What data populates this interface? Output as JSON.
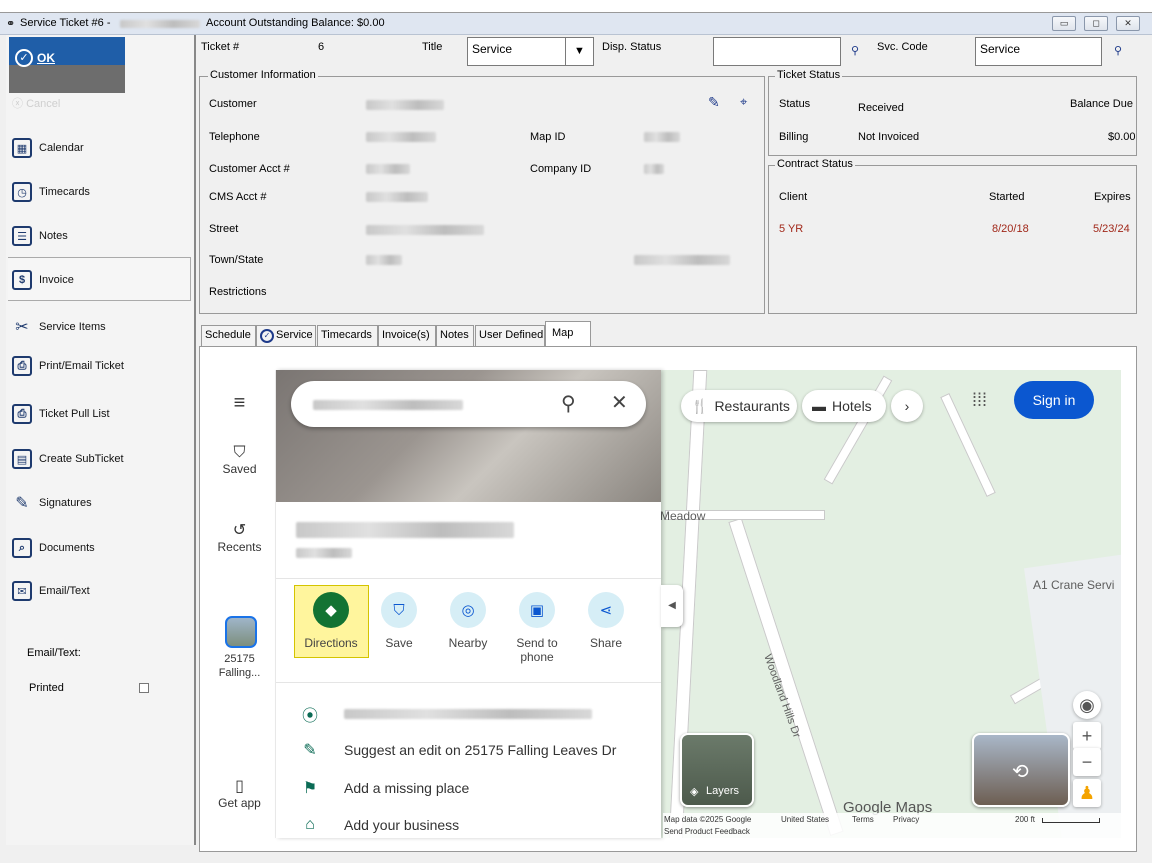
{
  "window": {
    "title_prefix": "Service Ticket #6 -",
    "balance": "Account Outstanding Balance: $0.00",
    "min": "▭",
    "max": "◻",
    "close": "✕"
  },
  "sidebar": {
    "ok": "OK",
    "cancel": "Cancel",
    "items": [
      {
        "label": "Calendar",
        "icon": "calendar-icon"
      },
      {
        "label": "Timecards",
        "icon": "timecards-icon"
      },
      {
        "label": "Notes",
        "icon": "notes-icon"
      },
      {
        "label": "Invoice",
        "icon": "dollar-icon"
      },
      {
        "label": "Service Items",
        "icon": "tools-icon"
      },
      {
        "label": "Print/Email Ticket",
        "icon": "printer-icon"
      },
      {
        "label": "Ticket Pull List",
        "icon": "printer-icon"
      },
      {
        "label": "Create SubTicket",
        "icon": "subticket-icon"
      },
      {
        "label": "Signatures",
        "icon": "pen-icon"
      },
      {
        "label": "Documents",
        "icon": "documents-icon"
      },
      {
        "label": "Email/Text",
        "icon": "envelope-icon"
      }
    ],
    "email_text_label": "Email/Text:",
    "printed_label": "Printed"
  },
  "header": {
    "ticket_label": "Ticket #",
    "ticket_value": "6",
    "title_label": "Title",
    "title_value": "Service",
    "disp_label": "Disp. Status",
    "disp_value": "",
    "svc_label": "Svc. Code",
    "svc_value": "Service"
  },
  "customer": {
    "caption": "Customer Information",
    "labels": [
      "Customer",
      "Telephone",
      "Customer Acct #",
      "CMS Acct #",
      "Street",
      "Town/State",
      "Restrictions"
    ],
    "map_id_label": "Map ID",
    "company_id_label": "Company ID"
  },
  "ticket_status": {
    "caption": "Ticket Status",
    "status_label": "Status",
    "status_value": "Received",
    "balance_label": "Balance Due",
    "billing_label": "Billing",
    "billing_value": "Not Invoiced",
    "balance_value": "$0.00"
  },
  "contract": {
    "caption": "Contract Status",
    "headers": [
      "Client",
      "Started",
      "Expires"
    ],
    "row": [
      "5 YR",
      "8/20/18",
      "5/23/24"
    ]
  },
  "tabs": [
    "Schedule",
    "Service",
    "Timecards",
    "Invoice(s)",
    "Notes",
    "User Defined",
    "Map"
  ],
  "map": {
    "rail": {
      "saved": "Saved",
      "recents": "Recents",
      "thumb": "25175 Falling...",
      "get_app": "Get app"
    },
    "actions": [
      "Directions",
      "Save",
      "Nearby",
      "Send to phone",
      "Share"
    ],
    "rows": [
      "Suggest an edit on 25175 Falling Leaves Dr",
      "Add a missing place",
      "Add your business"
    ],
    "chips": {
      "restaurants": "Restaurants",
      "hotels": "Hotels",
      "sign_in": "Sign in"
    },
    "labels": {
      "meadow": "Meadow",
      "crane": "A1 Crane Servi",
      "woodland": "Woodland Hills Dr",
      "layers": "Layers",
      "google": "Google Maps"
    },
    "footer": {
      "data": "Map data ©2025 Google",
      "feedback": "Send Product Feedback",
      "country": "United States",
      "terms": "Terms",
      "privacy": "Privacy",
      "scale": "200 ft"
    }
  }
}
